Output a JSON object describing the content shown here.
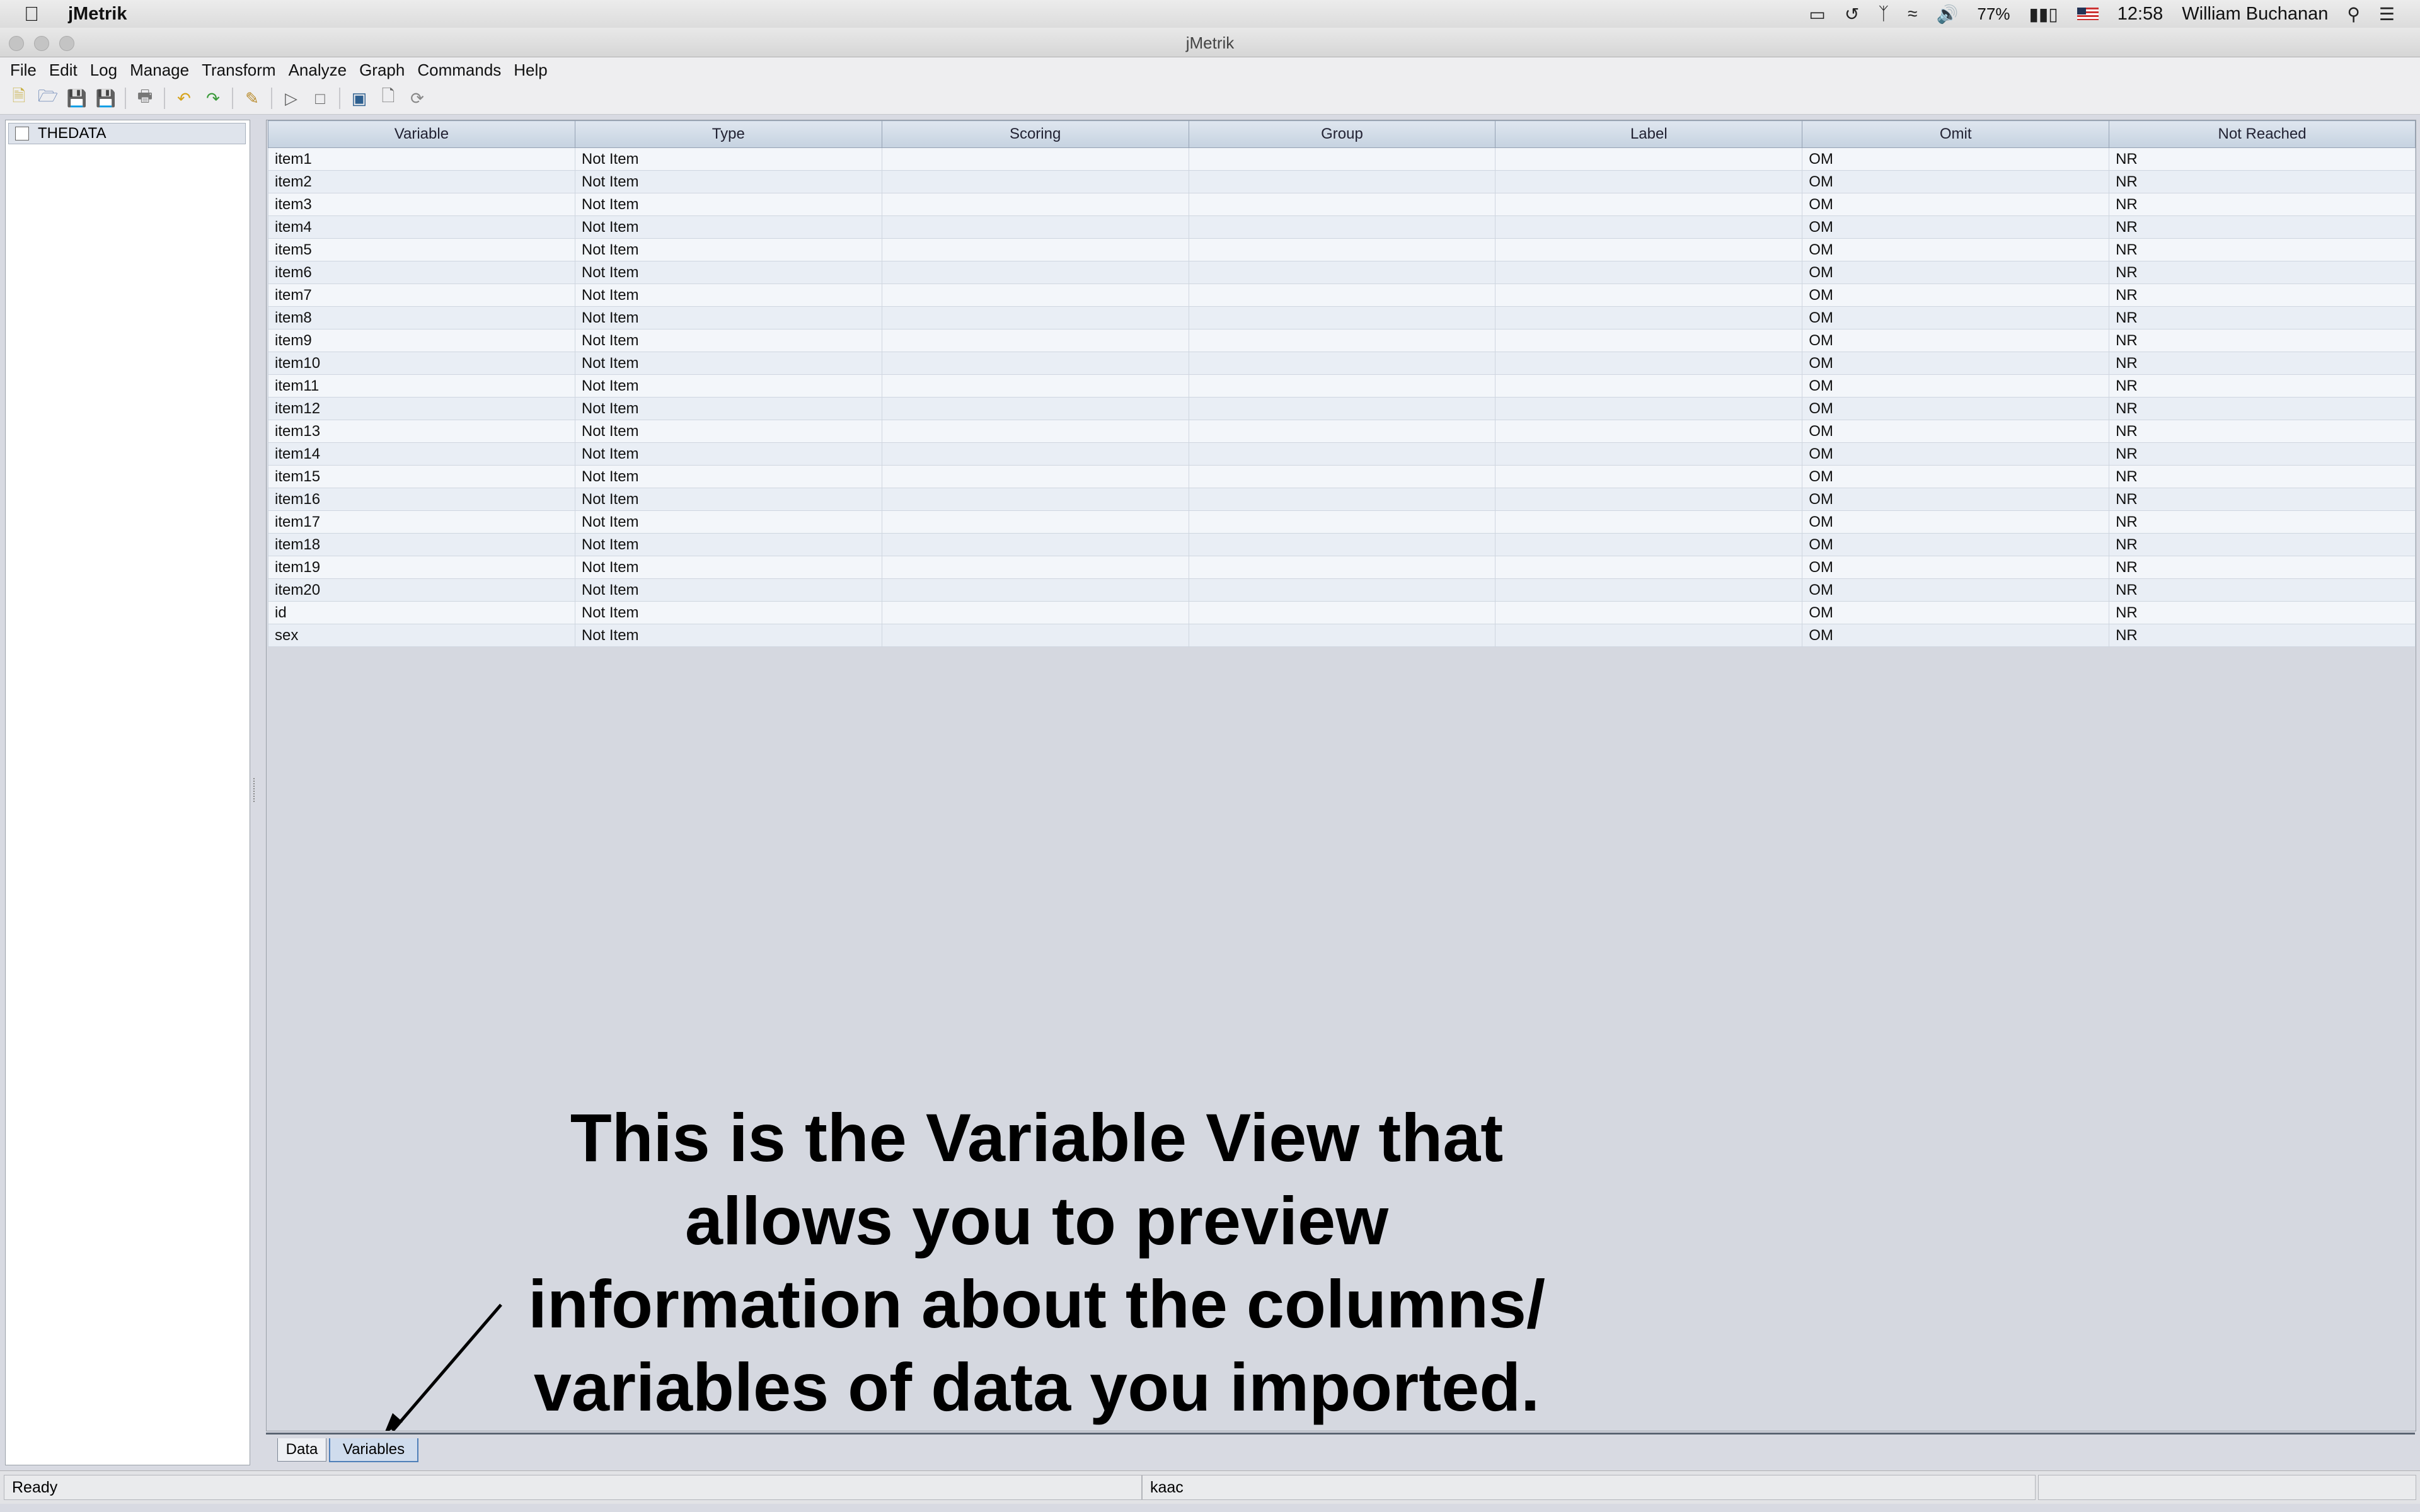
{
  "menubar": {
    "app_name": "jMetrik",
    "battery": "77%",
    "clock": "12:58",
    "user": "William Buchanan"
  },
  "window": {
    "title": "jMetrik"
  },
  "app_menu": [
    "File",
    "Edit",
    "Log",
    "Manage",
    "Transform",
    "Analyze",
    "Graph",
    "Commands",
    "Help"
  ],
  "tree": {
    "root_label": "THEDATA"
  },
  "table": {
    "columns": [
      "Variable",
      "Type",
      "Scoring",
      "Group",
      "Label",
      "Omit",
      "Not Reached"
    ],
    "rows": [
      [
        "item1",
        "Not Item",
        "",
        "",
        "",
        "OM",
        "NR"
      ],
      [
        "item2",
        "Not Item",
        "",
        "",
        "",
        "OM",
        "NR"
      ],
      [
        "item3",
        "Not Item",
        "",
        "",
        "",
        "OM",
        "NR"
      ],
      [
        "item4",
        "Not Item",
        "",
        "",
        "",
        "OM",
        "NR"
      ],
      [
        "item5",
        "Not Item",
        "",
        "",
        "",
        "OM",
        "NR"
      ],
      [
        "item6",
        "Not Item",
        "",
        "",
        "",
        "OM",
        "NR"
      ],
      [
        "item7",
        "Not Item",
        "",
        "",
        "",
        "OM",
        "NR"
      ],
      [
        "item8",
        "Not Item",
        "",
        "",
        "",
        "OM",
        "NR"
      ],
      [
        "item9",
        "Not Item",
        "",
        "",
        "",
        "OM",
        "NR"
      ],
      [
        "item10",
        "Not Item",
        "",
        "",
        "",
        "OM",
        "NR"
      ],
      [
        "item11",
        "Not Item",
        "",
        "",
        "",
        "OM",
        "NR"
      ],
      [
        "item12",
        "Not Item",
        "",
        "",
        "",
        "OM",
        "NR"
      ],
      [
        "item13",
        "Not Item",
        "",
        "",
        "",
        "OM",
        "NR"
      ],
      [
        "item14",
        "Not Item",
        "",
        "",
        "",
        "OM",
        "NR"
      ],
      [
        "item15",
        "Not Item",
        "",
        "",
        "",
        "OM",
        "NR"
      ],
      [
        "item16",
        "Not Item",
        "",
        "",
        "",
        "OM",
        "NR"
      ],
      [
        "item17",
        "Not Item",
        "",
        "",
        "",
        "OM",
        "NR"
      ],
      [
        "item18",
        "Not Item",
        "",
        "",
        "",
        "OM",
        "NR"
      ],
      [
        "item19",
        "Not Item",
        "",
        "",
        "",
        "OM",
        "NR"
      ],
      [
        "item20",
        "Not Item",
        "",
        "",
        "",
        "OM",
        "NR"
      ],
      [
        "id",
        "Not Item",
        "",
        "",
        "",
        "OM",
        "NR"
      ],
      [
        "sex",
        "Not Item",
        "",
        "",
        "",
        "OM",
        "NR"
      ]
    ]
  },
  "annotation": {
    "lines": [
      "This is the Variable View that",
      "allows you to preview",
      "information about the columns/",
      "variables of data you imported."
    ]
  },
  "tabs": {
    "data": "Data",
    "variables": "Variables",
    "active": "Variables"
  },
  "status": {
    "left": "Ready",
    "middle": "kaac",
    "right": ""
  },
  "colors": {
    "header": "#c5d2e0",
    "panel": "#d5d8e0",
    "active_tab": "#4f7fb8"
  }
}
